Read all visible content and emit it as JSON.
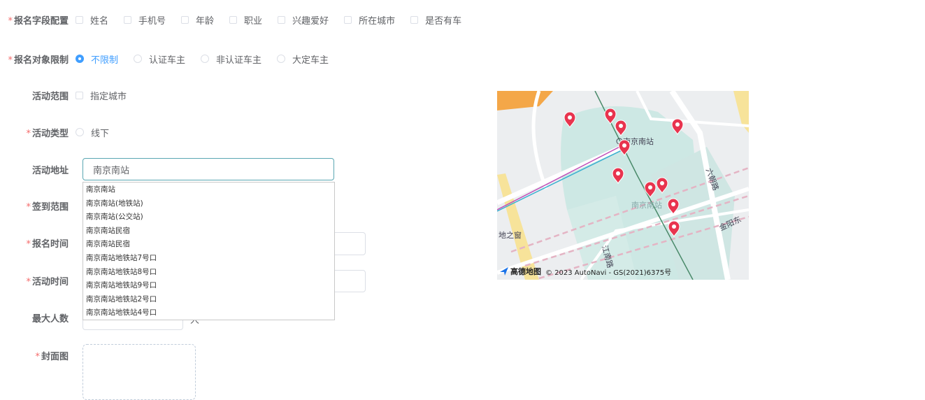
{
  "form": {
    "fields": {
      "label": "报名字段配置",
      "required": true,
      "options": [
        "姓名",
        "手机号",
        "年龄",
        "职业",
        "兴趣爱好",
        "所在城市",
        "是否有车"
      ]
    },
    "target": {
      "label": "报名对象限制",
      "required": true,
      "selected": "不限制",
      "options": [
        "不限制",
        "认证车主",
        "非认证车主",
        "大定车主"
      ]
    },
    "scope": {
      "label": "活动范围",
      "required": false,
      "option": "指定城市"
    },
    "type": {
      "label": "活动类型",
      "required": true,
      "option": "线下"
    },
    "address": {
      "label": "活动地址",
      "required": false,
      "value": "南京南站"
    },
    "checkin": {
      "label": "签到范围",
      "required": true
    },
    "signup_time": {
      "label": "报名时间",
      "required": true
    },
    "activity_time": {
      "label": "活动时间",
      "required": true
    },
    "max_people": {
      "label": "最大人数",
      "required": false,
      "unit": "人"
    },
    "cover": {
      "label": "封面图",
      "required": true
    }
  },
  "suggestions": [
    "南京南站",
    "南京南站(地铁站)",
    "南京南站(公交站)",
    "南京南站民宿",
    "南京南站民宿",
    "南京南站地铁站7号口",
    "南京南站地铁站8号口",
    "南京南站地铁站9号口",
    "南京南站地铁站2号口",
    "南京南站地铁站4号口"
  ],
  "map": {
    "station_label": "南京南站",
    "station_label_2": "南京南站",
    "road_labels": [
      "六朝路",
      "金阳东",
      "江南路",
      "地之窗"
    ],
    "brand": "高德地图",
    "copyright": "© 2023 AutoNavi - GS(2021)6375号",
    "marker_count": 11
  },
  "colors": {
    "accent": "#409eff",
    "required": "#f56c6c",
    "marker": "#e8344e"
  }
}
